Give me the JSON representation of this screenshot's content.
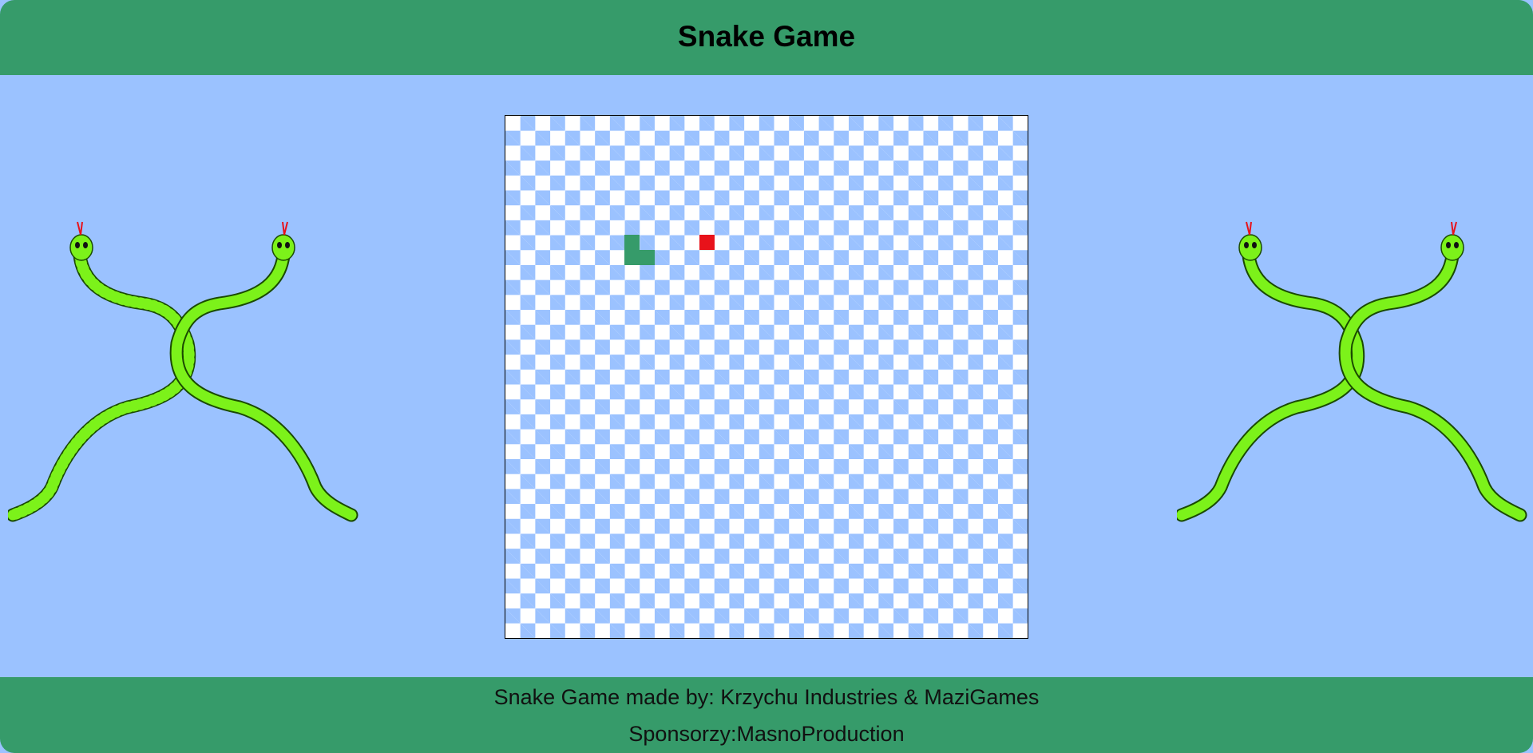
{
  "header": {
    "title": "Snake Game"
  },
  "footer": {
    "credits": "Snake Game made by: Krzychu Industries & MaziGames",
    "sponsors": "Sponsorzy:MasnoProduction"
  },
  "game": {
    "grid_size": 35,
    "snake": [
      {
        "col": 8,
        "row": 8
      },
      {
        "col": 8,
        "row": 9
      },
      {
        "col": 9,
        "row": 9
      }
    ],
    "food": {
      "col": 13,
      "row": 8
    }
  },
  "colors": {
    "background": "#9bc2ff",
    "bar": "#369b6a",
    "snake": "#369b6a",
    "food": "#e8121a",
    "board_light": "#ffffff",
    "board_dark": "#9bc2ff"
  },
  "decorations": {
    "left": "crossed-snakes-icon",
    "right": "crossed-snakes-icon"
  }
}
